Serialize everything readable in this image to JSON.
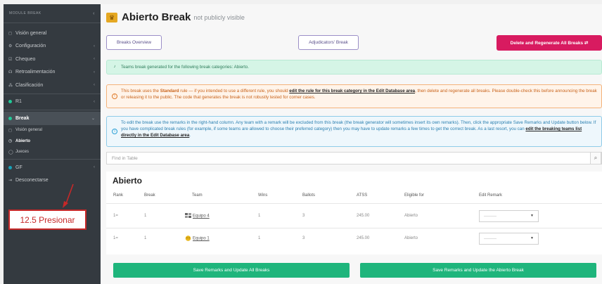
{
  "sidebar": {
    "brand": "MODULE BREAK",
    "items": [
      {
        "icon": "◻",
        "label": "Visión general"
      },
      {
        "icon": "⚙",
        "label": "Configuración"
      },
      {
        "icon": "☑",
        "label": "Chequeo"
      },
      {
        "icon": "☊",
        "label": "Retroalimentación"
      },
      {
        "icon": "⁂",
        "label": "Clasificación"
      },
      {
        "icon": "●",
        "label": "R1"
      },
      {
        "icon": "●",
        "label": "Break"
      }
    ],
    "subitems": [
      {
        "icon": "◻",
        "label": "Visión general"
      },
      {
        "icon": "◷",
        "label": "Abierto"
      },
      {
        "icon": "◯",
        "label": "Jueces"
      }
    ],
    "after": [
      {
        "icon": "●",
        "label": "GF"
      },
      {
        "icon": "⇥",
        "label": "Desconectarse"
      }
    ]
  },
  "callout": "12.5 Presionar",
  "header": {
    "title": "Abierto Break",
    "subtitle": "not publicly visible"
  },
  "buttons": {
    "overview": "Breaks Overview",
    "adjudicators": "Adjudicators' Break",
    "delete_regen": "Delete and Regenerate All Breaks ⇄",
    "save_all": "Save Remarks and Update All Breaks",
    "save_abierto": "Save Remarks and Update the Abierto Break"
  },
  "alerts": {
    "green": "Teams break generated for the following break categories: Abierto.",
    "orange_a": "This break uses the ",
    "orange_rule": "Standard",
    "orange_b": " rule — if you intended to use a different rule, you should ",
    "orange_link": "edit the rule for this break category in the Edit Database area",
    "orange_c": ", then delete and regenerate all breaks. Please double-check this before announcing the break or releasing it to the public. The code that generates the break is not robustly tested for corner cases.",
    "blue_a": "To edit the break use the remarks in the right-hand column. Any team with a remark will be excluded from this break (the break generator will sometimes insert its own remarks). Then, click the appropriate Save Remarks and Update button below. If you have complicated break rules (for example, if some teams are allowed to choose their preferred category) then you may have to update remarks a few times to get the correct break. As a last resort, you can ",
    "blue_link": "edit the breaking teams list directly in the Edit Database area",
    "blue_b": "."
  },
  "search": {
    "placeholder": "Find in Table"
  },
  "table": {
    "title": "Abierto",
    "headers": [
      "Rank",
      "Break",
      "Team",
      "Wins",
      "Ballots",
      "ATSS",
      "Eligible for",
      "Edit Remark"
    ],
    "rows": [
      {
        "rank": "1=",
        "brk": "1",
        "team": "Equipo 4",
        "wins": "1",
        "ballots": "3",
        "atss": "245.00",
        "eligible": "Abierto",
        "remark": "---------"
      },
      {
        "rank": "1=",
        "brk": "1",
        "team": "Equipo 1",
        "wins": "1",
        "ballots": "3",
        "atss": "245.00",
        "eligible": "Abierto",
        "remark": "---------"
      }
    ]
  },
  "colors": {
    "accent_pink": "#d81b60",
    "accent_green": "#1fb57c",
    "sidebar": "#343a40"
  }
}
